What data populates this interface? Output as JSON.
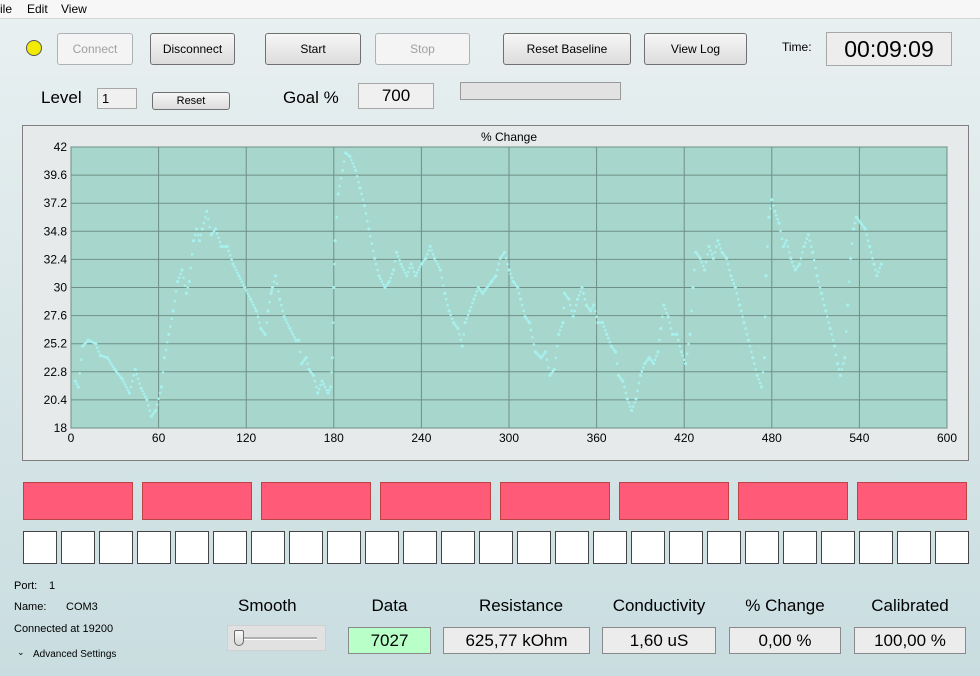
{
  "menu": [
    "ile",
    "Edit",
    "View"
  ],
  "status_led_color": "#f2ea02",
  "toolbar": {
    "connect": "Connect",
    "disconnect": "Disconnect",
    "start": "Start",
    "stop": "Stop",
    "reset_baseline": "Reset Baseline",
    "view_log": "View Log"
  },
  "time": {
    "label": "Time:",
    "value": "00:09:09"
  },
  "level": {
    "label": "Level",
    "value": "1",
    "reset": "Reset"
  },
  "goal": {
    "label": "Goal %",
    "value": "700",
    "progress": 0.0
  },
  "chart_data": {
    "type": "scatter",
    "title": "% Change",
    "xlabel": "",
    "ylabel": "",
    "xlim": [
      0,
      600
    ],
    "ylim": [
      18,
      42
    ],
    "x_ticks": [
      0,
      60,
      120,
      180,
      240,
      300,
      360,
      420,
      480,
      540,
      600
    ],
    "y_ticks": [
      18,
      20.4,
      22.8,
      25.2,
      27.6,
      30,
      32.4,
      34.8,
      37.2,
      39.6,
      42
    ],
    "y_tick_labels": [
      "18",
      "20.4",
      "22.8",
      "25.2",
      "27.6",
      "30",
      "32.4",
      "34.8",
      "37.2",
      "39.6",
      "42"
    ],
    "grid": true,
    "plot_bg": "#a7d7cc",
    "series_color": "#a8f0ee",
    "series": [
      {
        "points": [
          [
            3,
            22
          ],
          [
            5,
            21.5
          ],
          [
            8,
            25
          ],
          [
            12,
            25.5
          ],
          [
            17,
            25.2
          ],
          [
            20,
            24.2
          ],
          [
            25,
            24
          ],
          [
            30,
            23
          ],
          [
            35,
            22.2
          ],
          [
            40,
            21
          ],
          [
            44,
            23
          ],
          [
            48,
            21.4
          ],
          [
            52,
            20.4
          ],
          [
            55,
            19
          ],
          [
            58,
            19.5
          ],
          [
            62,
            21.5
          ],
          [
            64,
            24
          ],
          [
            67,
            26
          ],
          [
            70,
            28
          ],
          [
            73,
            30.5
          ],
          [
            76,
            31.5
          ],
          [
            79,
            29.5
          ],
          [
            81,
            30.5
          ],
          [
            84,
            34
          ],
          [
            86,
            35
          ],
          [
            88,
            34
          ],
          [
            90,
            35
          ],
          [
            93,
            36.5
          ],
          [
            96,
            34.5
          ],
          [
            99,
            35
          ],
          [
            103,
            33.5
          ],
          [
            107,
            33.5
          ],
          [
            111,
            32
          ],
          [
            115,
            31
          ],
          [
            119,
            30
          ],
          [
            123,
            29
          ],
          [
            127,
            28
          ],
          [
            130,
            26.5
          ],
          [
            133,
            26
          ],
          [
            135,
            28
          ],
          [
            137,
            29.5
          ],
          [
            138,
            30
          ],
          [
            140,
            31
          ],
          [
            143,
            29
          ],
          [
            146,
            27.5
          ],
          [
            150,
            26.5
          ],
          [
            154,
            25.5
          ],
          [
            156,
            25.5
          ],
          [
            158,
            23.5
          ],
          [
            161,
            24
          ],
          [
            163,
            23
          ],
          [
            166,
            22.5
          ],
          [
            169,
            21
          ],
          [
            172,
            22
          ],
          [
            176,
            21
          ],
          [
            178,
            21.5
          ],
          [
            179,
            24
          ],
          [
            180,
            30
          ],
          [
            181,
            34
          ],
          [
            183,
            38
          ],
          [
            186,
            40
          ],
          [
            188,
            41.5
          ],
          [
            191,
            41.2
          ],
          [
            195,
            40
          ],
          [
            198,
            38.5
          ],
          [
            201,
            37
          ],
          [
            204,
            35
          ],
          [
            208,
            32.5
          ],
          [
            211,
            31
          ],
          [
            215,
            30
          ],
          [
            218,
            30.5
          ],
          [
            221,
            31.5
          ],
          [
            223,
            33
          ],
          [
            226,
            32
          ],
          [
            230,
            31
          ],
          [
            233,
            32
          ],
          [
            236,
            31
          ],
          [
            240,
            32
          ],
          [
            243,
            32.5
          ],
          [
            246,
            33.5
          ],
          [
            249,
            32.5
          ],
          [
            253,
            31.5
          ],
          [
            256,
            29.5
          ],
          [
            259,
            28
          ],
          [
            262,
            27
          ],
          [
            265,
            26.5
          ],
          [
            268,
            25
          ],
          [
            270,
            27
          ],
          [
            273,
            28
          ],
          [
            276,
            29
          ],
          [
            279,
            30
          ],
          [
            282,
            29.5
          ],
          [
            285,
            30
          ],
          [
            288,
            30.5
          ],
          [
            291,
            31
          ],
          [
            294,
            32.5
          ],
          [
            297,
            33
          ],
          [
            300,
            31.5
          ],
          [
            303,
            30.5
          ],
          [
            306,
            30
          ],
          [
            308,
            29
          ],
          [
            311,
            27.5
          ],
          [
            314,
            27
          ],
          [
            318,
            24.5
          ],
          [
            322,
            24
          ],
          [
            325,
            24.5
          ],
          [
            328,
            22.5
          ],
          [
            331,
            23
          ],
          [
            334,
            26
          ],
          [
            337,
            27
          ],
          [
            338,
            29.5
          ],
          [
            341,
            29
          ],
          [
            344,
            27.5
          ],
          [
            347,
            29
          ],
          [
            350,
            30
          ],
          [
            353,
            28.5
          ],
          [
            356,
            28
          ],
          [
            358,
            28.5
          ],
          [
            361,
            27
          ],
          [
            364,
            27
          ],
          [
            367,
            26
          ],
          [
            370,
            25
          ],
          [
            373,
            24.5
          ],
          [
            375,
            22.5
          ],
          [
            378,
            22
          ],
          [
            381,
            20.5
          ],
          [
            384,
            19.5
          ],
          [
            387,
            20.5
          ],
          [
            390,
            22.5
          ],
          [
            393,
            23.5
          ],
          [
            396,
            24
          ],
          [
            399,
            23.5
          ],
          [
            402,
            24.5
          ],
          [
            404,
            26.5
          ],
          [
            406,
            28.5
          ],
          [
            409,
            27.5
          ],
          [
            412,
            26
          ],
          [
            415,
            26
          ],
          [
            418,
            24.5
          ],
          [
            421,
            23.5
          ],
          [
            424,
            26
          ],
          [
            426,
            30
          ],
          [
            428,
            33
          ],
          [
            431,
            32.5
          ],
          [
            434,
            31.5
          ],
          [
            437,
            33.5
          ],
          [
            440,
            32.5
          ],
          [
            443,
            34
          ],
          [
            446,
            33
          ],
          [
            449,
            32.5
          ],
          [
            452,
            31
          ],
          [
            455,
            30
          ],
          [
            458,
            28.5
          ],
          [
            461,
            27
          ],
          [
            464,
            25.5
          ],
          [
            467,
            24
          ],
          [
            470,
            22.5
          ],
          [
            473,
            21.5
          ],
          [
            475,
            24
          ],
          [
            476,
            31
          ],
          [
            478,
            36
          ],
          [
            480,
            37.5
          ],
          [
            482,
            36.5
          ],
          [
            485,
            35.5
          ],
          [
            488,
            33.5
          ],
          [
            490,
            34
          ],
          [
            493,
            32.5
          ],
          [
            496,
            31.5
          ],
          [
            499,
            32
          ],
          [
            502,
            33.5
          ],
          [
            505,
            34.5
          ],
          [
            508,
            33
          ],
          [
            511,
            31
          ],
          [
            514,
            29.5
          ],
          [
            517,
            28
          ],
          [
            520,
            26.5
          ],
          [
            523,
            25
          ],
          [
            525,
            23.5
          ],
          [
            527,
            22.5
          ],
          [
            530,
            24
          ],
          [
            532,
            28.5
          ],
          [
            534,
            32.5
          ],
          [
            536,
            35
          ],
          [
            538,
            36
          ],
          [
            541,
            35.5
          ],
          [
            544,
            35
          ],
          [
            547,
            33.5
          ],
          [
            550,
            32
          ],
          [
            552,
            31
          ],
          [
            555,
            32
          ]
        ]
      }
    ]
  },
  "indicators": {
    "top_row_count": 8,
    "top_row_color": "#ff5a78",
    "bottom_row_count": 25,
    "bottom_row_color": "#ffffff"
  },
  "connection": {
    "port_label": "Port:",
    "port_value": "1",
    "name_label": "Name:",
    "name_value": "COM3",
    "status": "Connected at 19200",
    "advanced": "Advanced Settings"
  },
  "smooth": {
    "label": "Smooth",
    "level": 0.0
  },
  "metrics": [
    {
      "label": "Data",
      "value": "7027",
      "color": "#b9ffc8"
    },
    {
      "label": "Resistance",
      "value": "625,77 kOhm",
      "color": "#ececec"
    },
    {
      "label": "Conductivity",
      "value": "1,60 uS",
      "color": "#ececec"
    },
    {
      "label": "% Change",
      "value": "0,00 %",
      "color": "#ececec"
    },
    {
      "label": "Calibrated",
      "value": "100,00 %",
      "color": "#ececec"
    }
  ]
}
